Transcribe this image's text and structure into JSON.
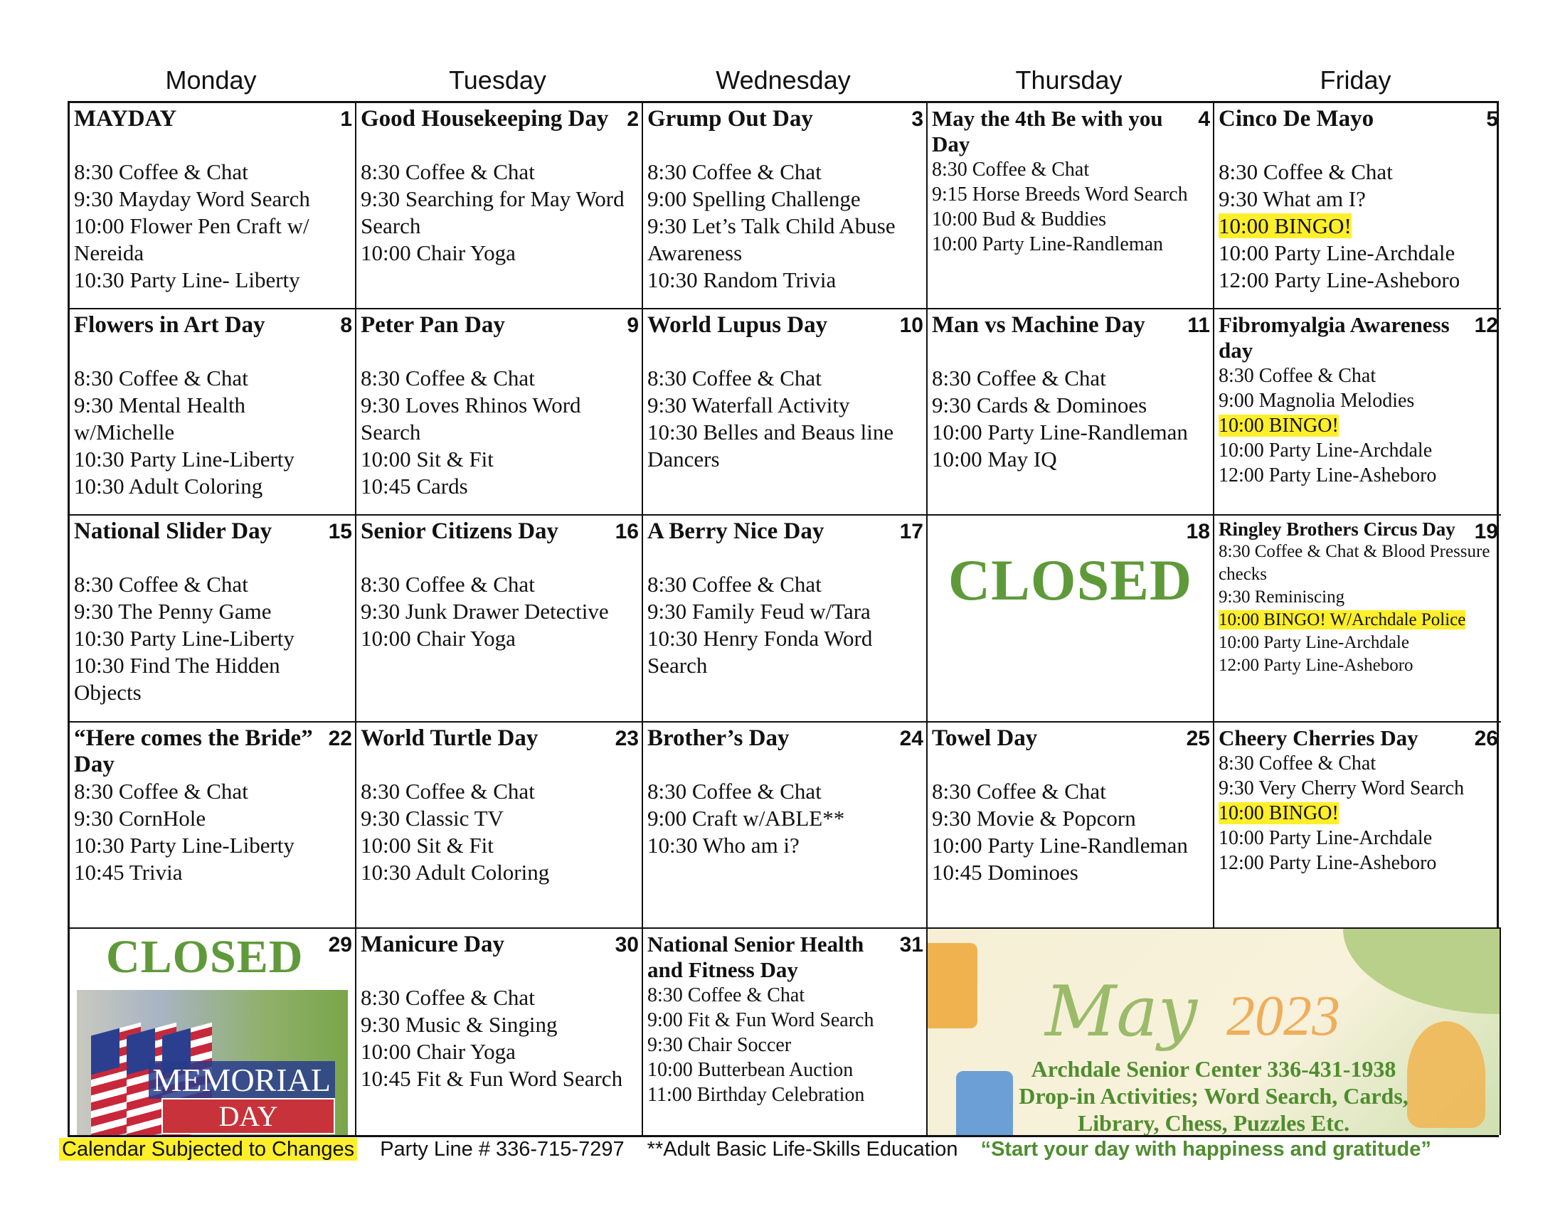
{
  "weekdays": [
    "Monday",
    "Tuesday",
    "Wednesday",
    "Thursday",
    "Friday"
  ],
  "colors": {
    "highlight": "#ffef2a",
    "closed_green": "#5f9a3a",
    "quote_green": "#4e8d2e"
  },
  "days": [
    {
      "num": "1",
      "title": "MAYDAY",
      "events": [
        "8:30 Coffee & Chat",
        "9:30 Mayday Word Search",
        "10:00 Flower Pen Craft w/ Nereida",
        "10:30 Party Line- Liberty"
      ]
    },
    {
      "num": "2",
      "title": "Good Housekeeping Day",
      "events": [
        "8:30 Coffee & Chat",
        "9:30 Searching for May Word Search",
        "10:00 Chair Yoga"
      ]
    },
    {
      "num": "3",
      "title": "Grump Out Day",
      "events": [
        "8:30 Coffee & Chat",
        "9:00 Spelling Challenge",
        "9:30 Let’s Talk Child Abuse Awareness",
        "10:30 Random Trivia"
      ]
    },
    {
      "num": "4",
      "title": "May the 4th Be with you Day",
      "size": "small",
      "events": [
        "8:30 Coffee & Chat",
        "9:15 Horse Breeds Word Search",
        "10:00 Bud & Buddies",
        "10:00 Party Line-Randleman"
      ]
    },
    {
      "num": "5",
      "title": "Cinco De Mayo",
      "events": [
        "8:30 Coffee & Chat",
        "9:30 What am I?",
        "10:00 BINGO!",
        "10:00 Party Line-Archdale",
        "12:00 Party Line-Asheboro"
      ],
      "highlight": [
        2
      ]
    },
    {
      "num": "8",
      "title": "Flowers in Art Day",
      "events": [
        "8:30 Coffee & Chat",
        "9:30 Mental Health w/Michelle",
        "10:30 Party Line-Liberty",
        "10:30 Adult Coloring"
      ]
    },
    {
      "num": "9",
      "title": "Peter Pan Day",
      "events": [
        "8:30 Coffee & Chat",
        "9:30 Loves Rhinos Word Search",
        "10:00 Sit & Fit",
        "10:45 Cards"
      ]
    },
    {
      "num": "10",
      "title": "World Lupus Day",
      "events": [
        "8:30 Coffee & Chat",
        "9:30 Waterfall Activity",
        "10:30 Belles and Beaus line Dancers"
      ]
    },
    {
      "num": "11",
      "title": "Man vs Machine Day",
      "events": [
        "8:30 Coffee & Chat",
        "9:30 Cards & Dominoes",
        "10:00 Party Line-Randleman",
        "10:00 May IQ"
      ]
    },
    {
      "num": "12",
      "title": "Fibromyalgia Awareness day",
      "size": "small",
      "events": [
        "8:30 Coffee & Chat",
        "9:00 Magnolia Melodies",
        "10:00 BINGO!",
        "10:00 Party Line-Archdale",
        "12:00 Party Line-Asheboro"
      ],
      "highlight": [
        2
      ]
    },
    {
      "num": "15",
      "title": "National Slider Day",
      "events": [
        "8:30 Coffee & Chat",
        "9:30 The Penny Game",
        "10:30 Party Line-Liberty",
        "10:30 Find The Hidden Objects"
      ]
    },
    {
      "num": "16",
      "title": "Senior Citizens Day",
      "events": [
        "8:30 Coffee & Chat",
        "9:30 Junk Drawer Detective",
        "10:00 Chair Yoga"
      ]
    },
    {
      "num": "17",
      "title": "A Berry Nice Day",
      "events": [
        "8:30 Coffee & Chat",
        "9:30 Family Feud w/Tara",
        "10:30 Henry Fonda Word Search"
      ]
    },
    {
      "num": "18",
      "closed": "CLOSED"
    },
    {
      "num": "19",
      "title": "Ringley Brothers Circus Day",
      "size": "tiny",
      "events": [
        "8:30 Coffee & Chat & Blood Pressure checks",
        "9:30 Reminiscing",
        "10:00 BINGO! W/Archdale Police",
        "10:00 Party Line-Archdale",
        "12:00 Party Line-Asheboro"
      ],
      "highlight": [
        2
      ]
    },
    {
      "num": "22",
      "title": "“Here comes the Bride” Day",
      "events": [
        "8:30 Coffee & Chat",
        "9:30 CornHole",
        "10:30 Party Line-Liberty",
        "10:45 Trivia"
      ]
    },
    {
      "num": "23",
      "title": "World Turtle Day",
      "events": [
        "8:30 Coffee & Chat",
        "9:30 Classic TV",
        "10:00 Sit & Fit",
        "10:30 Adult Coloring"
      ]
    },
    {
      "num": "24",
      "title": "Brother’s Day",
      "events": [
        "8:30 Coffee & Chat",
        "9:00 Craft w/ABLE**",
        "10:30 Who am i?"
      ]
    },
    {
      "num": "25",
      "title": "Towel Day",
      "events": [
        "8:30 Coffee & Chat",
        "9:30 Movie & Popcorn",
        "10:00 Party Line-Randleman",
        "10:45 Dominoes"
      ]
    },
    {
      "num": "26",
      "title": "Cheery Cherries Day",
      "size": "small",
      "events": [
        "8:30 Coffee & Chat",
        "9:30 Very Cherry Word Search",
        "10:00 BINGO!",
        "10:00 Party Line-Archdale",
        "12:00 Party Line-Asheboro"
      ],
      "highlight": [
        2
      ]
    },
    {
      "num": "29",
      "closed": "CLOSED",
      "memorial": {
        "line1": "MEMORIAL",
        "line2": "DAY"
      }
    },
    {
      "num": "30",
      "title": "Manicure Day",
      "events": [
        "8:30 Coffee & Chat",
        "9:30 Music & Singing",
        "10:00 Chair Yoga",
        "10:45 Fit & Fun Word Search"
      ]
    },
    {
      "num": "31",
      "title": "National Senior Health and Fitness Day",
      "size": "small",
      "events": [
        "8:30 Coffee & Chat",
        "9:00 Fit & Fun Word Search",
        "9:30 Chair Soccer",
        "10:00 Butterbean Auction",
        "11:00 Birthday Celebration"
      ]
    }
  ],
  "banner": {
    "month": "May",
    "year": "2023",
    "lines": [
      "Archdale Senior Center 336-431-1938",
      "Drop-in Activities; Word Search, Cards,",
      "Library, Chess, Puzzles Etc."
    ]
  },
  "footer": {
    "note": "Calendar Subjected to Changes",
    "party_line": "Party Line # 336-715-7297",
    "able": "**Adult Basic Life-Skills Education",
    "quote": "“Start your day with happiness and gratitude”"
  }
}
